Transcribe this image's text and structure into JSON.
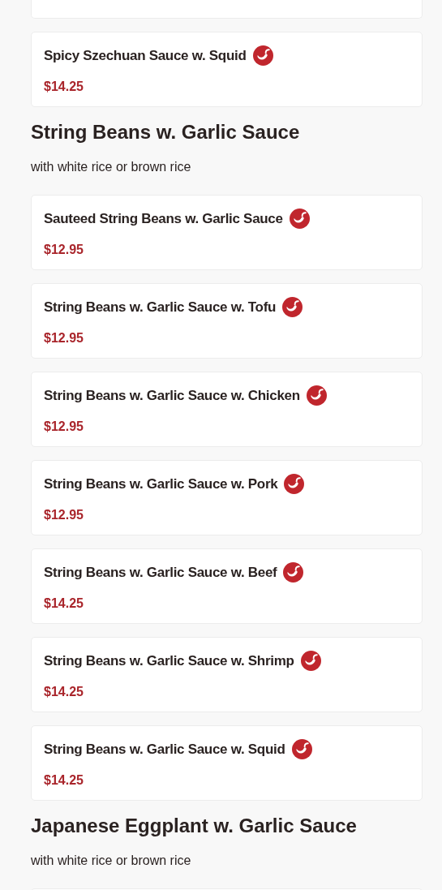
{
  "sections": [
    {
      "items": [
        {
          "name": "Spicy Szechuan Sauce w. Squid",
          "price": "$14.25",
          "spicy": true
        }
      ]
    },
    {
      "title": "String Beans w. Garlic Sauce",
      "subtitle": "with white rice or brown rice",
      "items": [
        {
          "name": "Sauteed String Beans w. Garlic Sauce",
          "price": "$12.95",
          "spicy": true
        },
        {
          "name": "String Beans w. Garlic Sauce w. Tofu",
          "price": "$12.95",
          "spicy": true
        },
        {
          "name": "String Beans w. Garlic Sauce w. Chicken",
          "price": "$12.95",
          "spicy": true
        },
        {
          "name": "String Beans w. Garlic Sauce w. Pork",
          "price": "$12.95",
          "spicy": true
        },
        {
          "name": "String Beans w. Garlic Sauce w. Beef",
          "price": "$14.25",
          "spicy": true
        },
        {
          "name": "String Beans w. Garlic Sauce w. Shrimp",
          "price": "$14.25",
          "spicy": true
        },
        {
          "name": "String Beans w. Garlic Sauce w. Squid",
          "price": "$14.25",
          "spicy": true
        }
      ]
    },
    {
      "title": "Japanese Eggplant w. Garlic Sauce",
      "subtitle": "with white rice or brown rice"
    }
  ]
}
